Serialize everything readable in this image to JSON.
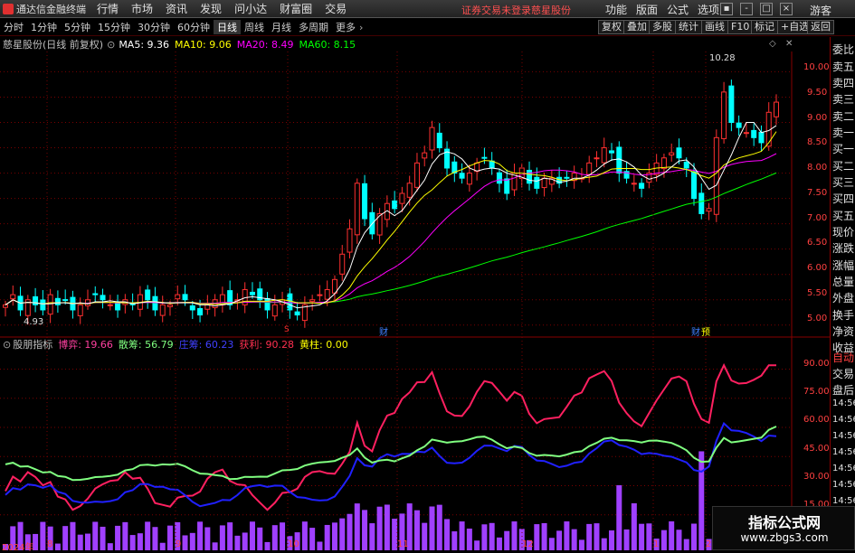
{
  "app": {
    "title": "通达信金融终端"
  },
  "menu": [
    "行情",
    "市场",
    "资讯",
    "发现",
    "问小达",
    "财富圈",
    "交易"
  ],
  "notice": {
    "login": "证券交易未登录",
    "stock": "慈星股份"
  },
  "right_menu": [
    "功能",
    "版面",
    "公式",
    "选项"
  ],
  "user": "游客",
  "periods": [
    "分时",
    "1分钟",
    "5分钟",
    "15分钟",
    "30分钟",
    "60分钟",
    "日线",
    "周线",
    "月线",
    "多周期",
    "更多"
  ],
  "active_period": "日线",
  "toolbar_right": [
    "复权",
    "叠加",
    "多股",
    "统计",
    "画线",
    "F10",
    "标记",
    "+自选",
    "返回"
  ],
  "main_title": {
    "stock": "慈星股份(日线 前复权)",
    "ma5": "MA5: 9.36",
    "ma10": "MA10: 9.06",
    "ma20": "MA20: 8.49",
    "ma60": "MA60: 8.15"
  },
  "colors": {
    "ma5": "#ffffff",
    "ma10": "#ffff00",
    "ma20": "#ff00ff",
    "ma60": "#00ff00",
    "up": "#ff3030",
    "down": "#00ffff",
    "grid": "#7a0000"
  },
  "price_axis": [
    "10.00",
    "9.50",
    "9.00",
    "8.50",
    "8.00",
    "7.50",
    "7.00",
    "6.50",
    "6.00",
    "5.50",
    "5.00"
  ],
  "annotations": {
    "high": "10.28",
    "low": "4.93",
    "mark_cai1": "财",
    "mark_cai2": "财",
    "mark_s": "S",
    "mark_yu": "预"
  },
  "indicator": {
    "name": "股朋指标",
    "items": [
      {
        "label": "博弈: 19.66",
        "color": "#ff40a0"
      },
      {
        "label": "散筹: 56.79",
        "color": "#80ff80"
      },
      {
        "label": "庄筹: 60.23",
        "color": "#4040ff"
      },
      {
        "label": "获利: 90.28",
        "color": "#ff3050"
      },
      {
        "label": "黄柱: 0.00",
        "color": "#ffff00"
      }
    ],
    "axis": [
      "90.00",
      "75.00",
      "60.00",
      "45.00",
      "30.00",
      "15.00"
    ]
  },
  "x_axis": [
    "2024年",
    "8",
    "9",
    "10",
    "11",
    "12",
    "1",
    "2"
  ],
  "side_panel": [
    "委比",
    "卖五",
    "卖四",
    "卖三",
    "卖二",
    "卖一",
    "买一",
    "买二",
    "买三",
    "买四",
    "买五",
    "现价",
    "涨跌",
    "涨幅",
    "总量",
    "外盘",
    "换手",
    "净资",
    "收益",
    "自动",
    "交易",
    "盘后",
    "14:56",
    "14:56",
    "14:56",
    "14:56",
    "14:56",
    "14:56",
    "14:56",
    "14:56"
  ],
  "watermark": {
    "line1": "指标公式网",
    "line2": "www.zbgs3.com"
  },
  "chart_data": {
    "type": "candlestick",
    "ylim": [
      4.8,
      10.4
    ],
    "approx_closes": [
      5.4,
      5.6,
      5.3,
      5.5,
      5.4,
      5.3,
      5.6,
      5.4,
      5.5,
      5.3,
      5.4,
      5.5,
      5.6,
      5.5,
      5.4,
      5.3,
      5.5,
      5.4,
      5.6,
      5.5,
      5.3,
      5.4,
      5.4,
      5.6,
      5.5,
      5.3,
      5.2,
      5.4,
      5.5,
      5.6,
      5.4,
      5.5,
      5.7,
      5.6,
      5.5,
      5.3,
      5.4,
      5.5,
      5.3,
      5.2,
      5.4,
      5.5,
      5.6,
      5.7,
      5.9,
      6.4,
      6.9,
      7.8,
      7.1,
      6.8,
      7.2,
      7.4,
      7.3,
      7.6,
      7.8,
      8.2,
      8.4,
      8.9,
      8.5,
      8.1,
      8.0,
      7.9,
      8.0,
      8.2,
      8.3,
      8.1,
      7.8,
      7.6,
      8.0,
      8.1,
      7.8,
      7.7,
      7.9,
      7.9,
      7.8,
      7.9,
      8.0,
      7.9,
      8.2,
      8.3,
      8.5,
      8.4,
      8.0,
      7.9,
      7.8,
      7.7,
      8.0,
      8.2,
      8.3,
      8.4,
      8.3,
      8.1,
      7.5,
      7.2,
      7.3,
      8.7,
      9.6,
      9.0,
      8.9,
      8.8,
      8.7,
      8.6,
      9.2,
      9.4
    ],
    "ma": [
      {
        "name": "MA5",
        "value": 9.36
      },
      {
        "name": "MA10",
        "value": 9.06
      },
      {
        "name": "MA20",
        "value": 8.49
      },
      {
        "name": "MA60",
        "value": 8.15
      }
    ]
  }
}
